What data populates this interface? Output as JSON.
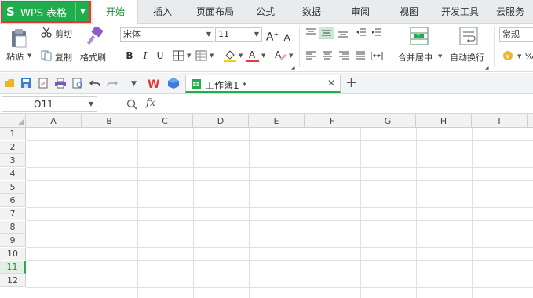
{
  "app": {
    "name": "WPS 表格",
    "logo": "S"
  },
  "menu_tabs": [
    "开始",
    "插入",
    "页面布局",
    "公式",
    "数据",
    "审阅",
    "视图",
    "开发工具",
    "云服务"
  ],
  "ribbon": {
    "paste": "粘贴",
    "cut": "剪切",
    "copy": "复制",
    "format_painter": "格式刷",
    "font_name": "宋体",
    "font_size": "11",
    "bold": "B",
    "italic": "I",
    "underline": "U",
    "font_grow": "A",
    "font_shrink": "A",
    "merge_center": "合并居中",
    "wrap_text": "自动换行",
    "number_format": "常规",
    "percent": "%"
  },
  "quick_access": {
    "doc_title": "工作簿1 *"
  },
  "formula_bar": {
    "cell_ref": "O11",
    "fx": "fx",
    "value": ""
  },
  "grid": {
    "columns": [
      "A",
      "B",
      "C",
      "D",
      "E",
      "F",
      "G",
      "H",
      "I"
    ],
    "rows": [
      "1",
      "2",
      "3",
      "4",
      "5",
      "6",
      "7",
      "8",
      "9",
      "10",
      "11",
      "12"
    ],
    "selected_row": "11"
  },
  "colors": {
    "accent": "#1fae4b",
    "highlight_border": "#e53935"
  }
}
